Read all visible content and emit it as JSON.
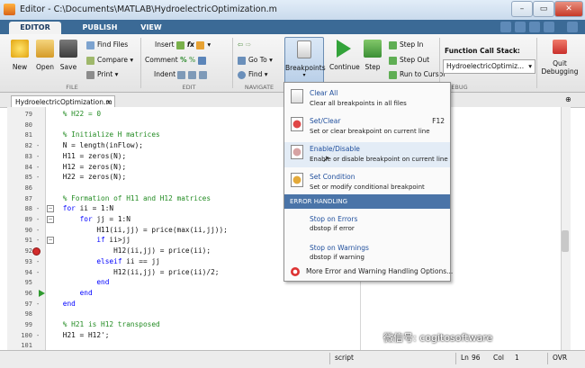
{
  "window": {
    "title": "Editor - C:\\Documents\\MATLAB\\HydroelectricOptimization.m"
  },
  "tabs": [
    "EDITOR",
    "PUBLISH",
    "VIEW"
  ],
  "toolstrip": {
    "file": {
      "new": "New",
      "open": "Open",
      "save": "Save",
      "find_files": "Find Files",
      "compare": "Compare",
      "print": "Print",
      "group": "FILE"
    },
    "edit": {
      "insert": "Insert",
      "comment": "Comment",
      "indent": "Indent",
      "group": "EDIT"
    },
    "navigate": {
      "go_to": "Go To",
      "find": "Find",
      "group": "NAVIGATE"
    },
    "breakpoints": {
      "label": "Breakpoints"
    },
    "run": {
      "continue": "Continue",
      "step": "Step",
      "step_in": "Step In",
      "step_out": "Step Out",
      "run_to_cursor": "Run to Cursor"
    },
    "callstack": {
      "label": "Function Call Stack:",
      "value": "HydroelectricOptimiz..."
    },
    "quit": {
      "line1": "Quit",
      "line2": "Debugging"
    },
    "debug_group": "DEBUG"
  },
  "document_tab": "HydroelectricOptimization.m",
  "code_lines": [
    {
      "num": "79",
      "mark": "",
      "html": "<span class='cm'>    % H22 = 0</span>"
    },
    {
      "num": "80",
      "mark": "",
      "html": ""
    },
    {
      "num": "81",
      "mark": "",
      "html": "<span class='cm'>    % Initialize H matrices</span>"
    },
    {
      "num": "82",
      "mark": "-",
      "html": "    N = length(inFlow);"
    },
    {
      "num": "83",
      "mark": "-",
      "html": "    H11 = zeros(N);"
    },
    {
      "num": "84",
      "mark": "-",
      "html": "    H12 = zeros(N);"
    },
    {
      "num": "85",
      "mark": "-",
      "html": "    H22 = zeros(N);"
    },
    {
      "num": "86",
      "mark": "",
      "html": ""
    },
    {
      "num": "87",
      "mark": "",
      "html": "<span class='cm'>    % Formation of H11 and H12 matrices</span>"
    },
    {
      "num": "88",
      "mark": "-",
      "html": "    <span class='kw'>for</span> ii = 1:N"
    },
    {
      "num": "89",
      "mark": "-",
      "html": "        <span class='kw'>for</span> jj = 1:N"
    },
    {
      "num": "90",
      "mark": "-",
      "html": "            H11(ii,jj) = price(max(ii,jj));"
    },
    {
      "num": "91",
      "mark": "-",
      "html": "            <span class='kw'>if</span> ii>jj"
    },
    {
      "num": "92",
      "mark": "bp",
      "html": "                H12(ii,jj) = price(ii);"
    },
    {
      "num": "93",
      "mark": "-",
      "html": "            <span class='kw'>elseif</span> ii == jj"
    },
    {
      "num": "94",
      "mark": "-",
      "html": "                H12(ii,jj) = price(ii)/2;"
    },
    {
      "num": "95",
      "mark": "",
      "html": "            <span class='kw'>end</span>"
    },
    {
      "num": "96",
      "mark": "arrow",
      "html": "        <span class='kw'>end</span>"
    },
    {
      "num": "97",
      "mark": "-",
      "html": "    <span class='kw'>end</span>"
    },
    {
      "num": "98",
      "mark": "",
      "html": ""
    },
    {
      "num": "99",
      "mark": "",
      "html": "<span class='cm'>    % H21 is H12 transposed</span>"
    },
    {
      "num": "100",
      "mark": "-",
      "html": "    H21 = H12';"
    },
    {
      "num": "101",
      "mark": "",
      "html": ""
    }
  ],
  "menu": {
    "items": [
      {
        "title": "Clear All",
        "desc": "Clear all breakpoints in all files",
        "key": ""
      },
      {
        "title": "Set/Clear",
        "desc": "Set or clear breakpoint on current line",
        "key": "F12"
      },
      {
        "title": "Enable/Disable",
        "desc": "Enable or disable breakpoint on current line",
        "key": ""
      },
      {
        "title": "Set Condition",
        "desc": "Set or modify conditional breakpoint",
        "key": ""
      }
    ],
    "header": "ERROR HANDLING",
    "error_items": [
      {
        "title": "Stop on Errors",
        "desc": "dbstop if error"
      },
      {
        "title": "Stop on Warnings",
        "desc": "dbstop if warning"
      }
    ],
    "more": "More Error and Warning Handling Options..."
  },
  "status": {
    "mode": "script",
    "ln_label": "Ln",
    "ln": "96",
    "col_label": "Col",
    "col": "1",
    "ovr": "OVR"
  },
  "watermark": "微信号: cogitosoftware"
}
